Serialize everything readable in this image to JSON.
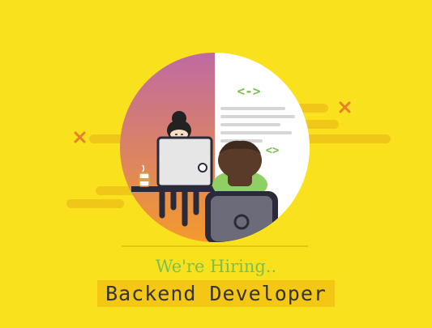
{
  "poster": {
    "tagline": "We're Hiring..",
    "role": "Backend Developer",
    "code_tag_top": "<->",
    "code_tag_bottom": "<>"
  },
  "colors": {
    "background": "#f9e11e",
    "tagline": "#7bbf4e",
    "role_highlight": "#f4c714",
    "gradient_top": "#bf6aa2",
    "gradient_bottom": "#f49a2c",
    "code_tag": "#7bbf4e"
  },
  "icons": [
    "cross-icon",
    "laptop-icon",
    "coffee-cup-icon",
    "code-tag-icon"
  ]
}
